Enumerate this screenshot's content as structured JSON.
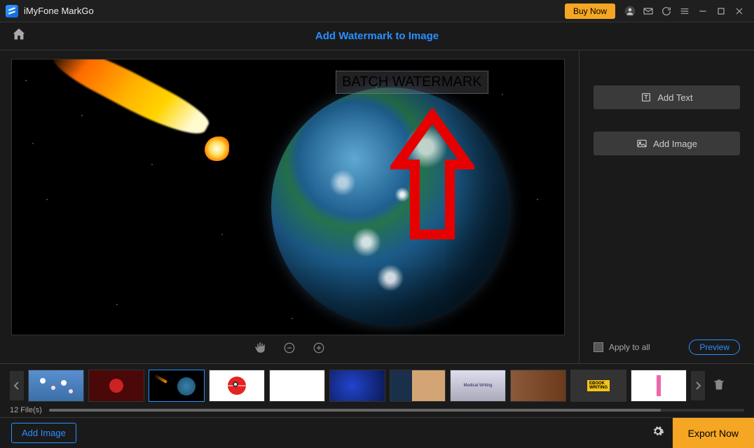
{
  "app": {
    "title": "iMyFone MarkGo",
    "buy_label": "Buy Now"
  },
  "header": {
    "title": "Add Watermark to Image"
  },
  "watermark": {
    "text": "BATCH WATERMARK"
  },
  "sidebar": {
    "add_text_label": "Add Text",
    "add_image_label": "Add Image",
    "apply_all_label": "Apply to all",
    "preview_label": "Preview"
  },
  "thumbs": {
    "file_count": "12 File(s)"
  },
  "footer": {
    "add_image_label": "Add Image",
    "export_label": "Export Now"
  }
}
